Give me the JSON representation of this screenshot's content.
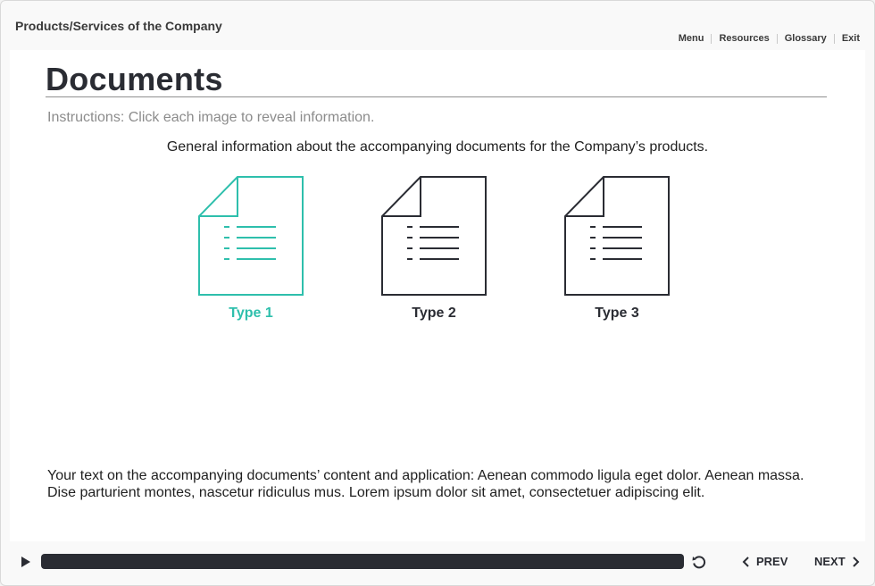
{
  "header": {
    "course_title": "Products/Services of the Company",
    "nav": [
      {
        "label": "Menu"
      },
      {
        "label": "Resources"
      },
      {
        "label": "Glossary"
      },
      {
        "label": "Exit"
      }
    ]
  },
  "slide": {
    "title": "Documents",
    "instructions": "Instructions: Click each image to reveal information.",
    "intro": "General information about the accompanying documents for the Company’s products.",
    "documents": [
      {
        "label": "Type 1",
        "icon": "document-icon",
        "active": true
      },
      {
        "label": "Type 2",
        "icon": "document-icon",
        "active": false
      },
      {
        "label": "Type 3",
        "icon": "document-icon",
        "active": false
      }
    ],
    "body": "Your text on the accompanying documents’ content and application: Aenean commodo ligula eget dolor. Aenean massa. Dise parturient montes, nascetur ridiculus mus. Lorem ipsum dolor sit amet, consectetuer adipiscing elit."
  },
  "controls": {
    "play_icon": "play-icon",
    "replay_icon": "replay-icon",
    "prev_label": "PREV",
    "next_label": "NEXT"
  },
  "colors": {
    "accent": "#2ebfac",
    "dark": "#2a2c33",
    "muted": "#8c8c8c"
  }
}
